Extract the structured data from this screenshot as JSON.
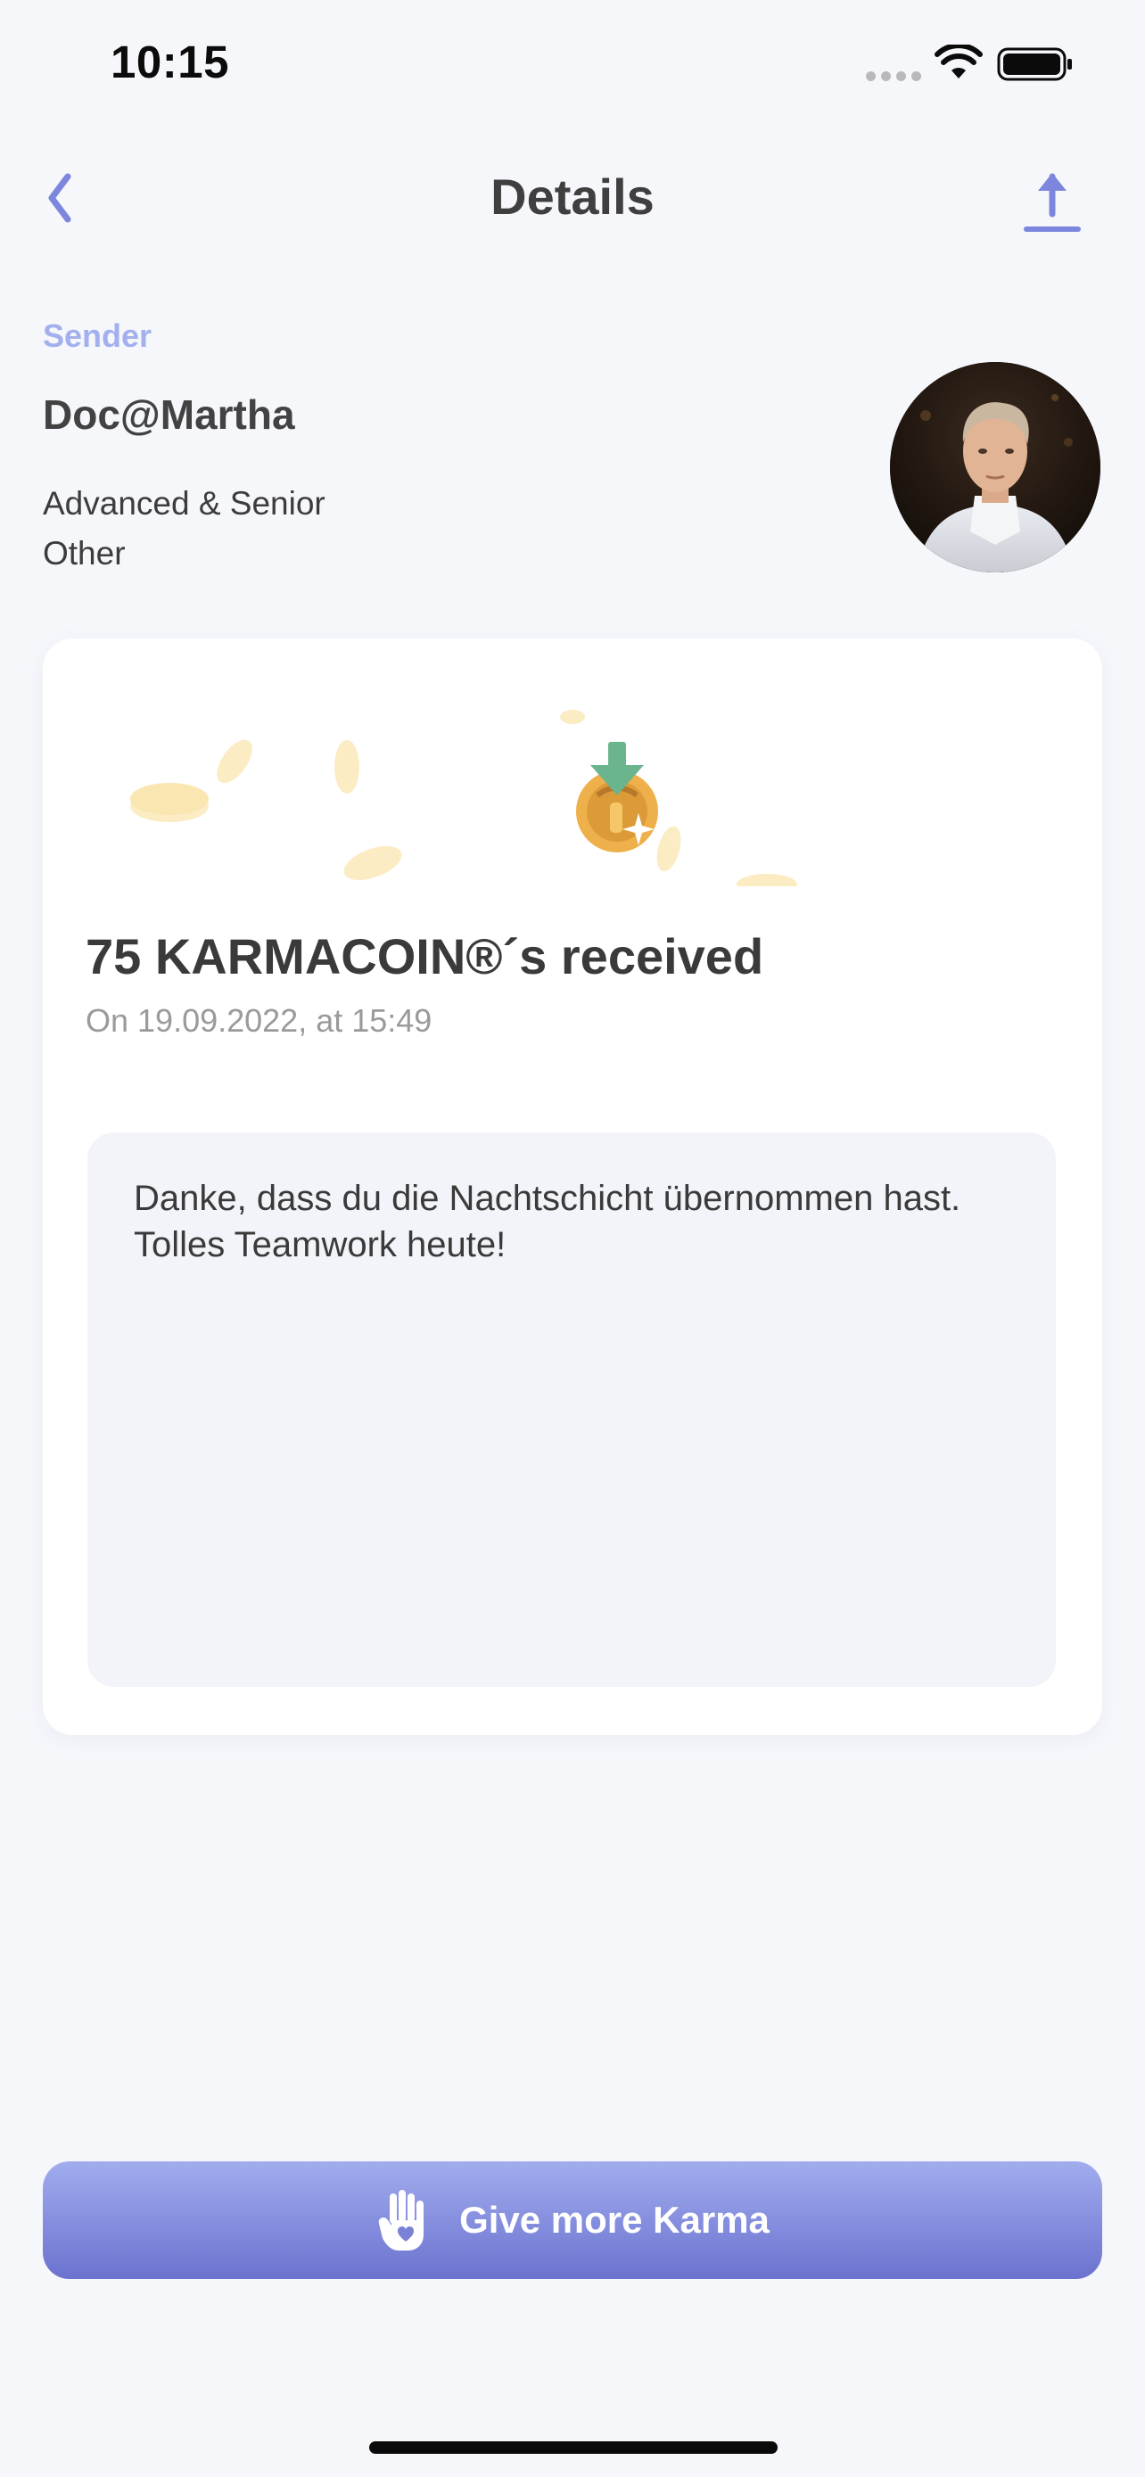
{
  "status_bar": {
    "time": "10:15"
  },
  "header": {
    "title": "Details",
    "back_icon": "chevron-left-icon",
    "share_icon": "upload-share-icon"
  },
  "sender": {
    "label": "Sender",
    "name": "Doc@Martha",
    "role": "Advanced & Senior",
    "department": "Other"
  },
  "transaction": {
    "amount_title": "75 KARMACOIN®´s received",
    "date_text": "On 19.09.2022, at 15:49",
    "message": "Danke, dass du die Nachtschicht übernommen hast. Tolles Teamwork heute!"
  },
  "action": {
    "give_karma_label": "Give more Karma",
    "icon": "hand-heart-icon"
  },
  "colors": {
    "accent": "#7c86dc",
    "sender_label": "#a3b0ee",
    "button_top": "#a1adee",
    "button_bottom": "#6b72cf",
    "background": "#f6f7fb"
  }
}
